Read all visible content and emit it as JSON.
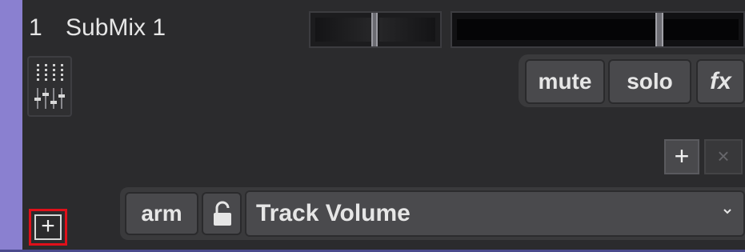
{
  "track": {
    "number": "1",
    "name": "SubMix 1"
  },
  "pan": {
    "value": 0.5
  },
  "volume": {
    "value": 0.69
  },
  "buttons": {
    "mute": "mute",
    "solo": "solo",
    "fx": "fx",
    "add": "+",
    "remove": "×"
  },
  "envelope": {
    "arm": "arm",
    "parameter": "Track Volume"
  },
  "footer": {
    "add": "+"
  },
  "colors": {
    "accent": "#8a80d0",
    "panel": "#2b2b2d",
    "highlight": "#e0101a"
  },
  "icons": {
    "mixer": "mixer-icon",
    "lock": "lock-icon",
    "chevron": "chevron-down-icon"
  }
}
